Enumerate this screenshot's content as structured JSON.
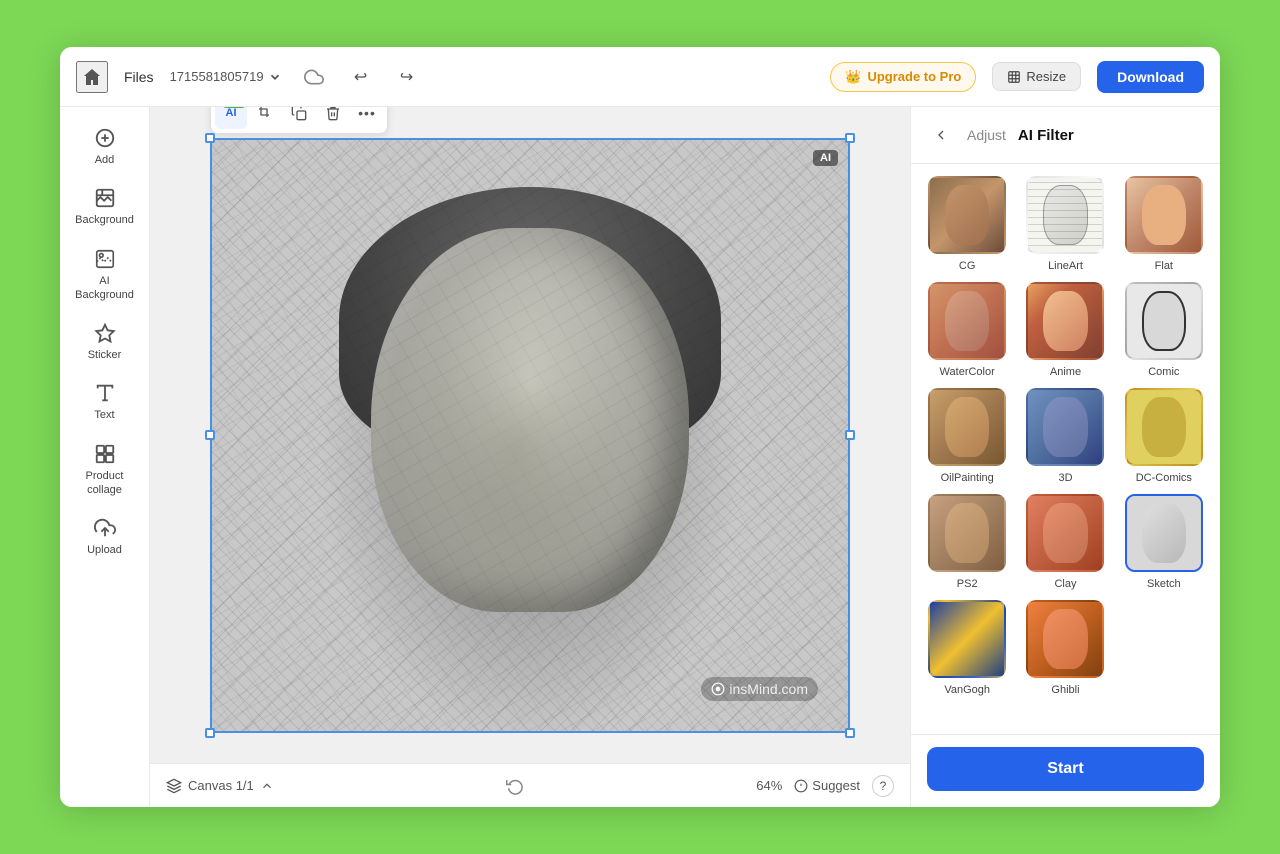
{
  "header": {
    "home_label": "Home",
    "files_label": "Files",
    "filename": "1715581805719",
    "undo_label": "Undo",
    "redo_label": "Redo",
    "upgrade_label": "Upgrade to Pro",
    "resize_label": "Resize",
    "download_label": "Download"
  },
  "sidebar": {
    "items": [
      {
        "id": "add",
        "label": "Add",
        "icon": "plus"
      },
      {
        "id": "background",
        "label": "Background",
        "icon": "background"
      },
      {
        "id": "ai-background",
        "label": "AI Background",
        "icon": "ai-background"
      },
      {
        "id": "sticker",
        "label": "Sticker",
        "icon": "sticker"
      },
      {
        "id": "text",
        "label": "Text",
        "icon": "text"
      },
      {
        "id": "product-collage",
        "label": "Product collage",
        "icon": "product-collage"
      },
      {
        "id": "upload",
        "label": "Upload",
        "icon": "upload"
      }
    ]
  },
  "canvas": {
    "name": "Canvas 1/1",
    "zoom": "64%",
    "suggest_label": "Suggest",
    "help_label": "?",
    "ai_badge": "AI",
    "watermark": "insMind.com"
  },
  "toolbar": {
    "buttons": [
      {
        "id": "ai-tool",
        "label": "AI",
        "has_new": true
      },
      {
        "id": "crop",
        "label": "Crop"
      },
      {
        "id": "duplicate",
        "label": "Duplicate"
      },
      {
        "id": "delete",
        "label": "Delete"
      },
      {
        "id": "more",
        "label": "More"
      }
    ]
  },
  "right_panel": {
    "back_label": "Back",
    "tab_adjust": "Adjust",
    "tab_aifilter": "AI Filter",
    "filters": [
      {
        "id": "cg",
        "label": "CG",
        "thumb_class": "ft-cg",
        "selected": false
      },
      {
        "id": "lineart",
        "label": "LineArt",
        "thumb_class": "ft-lineart",
        "selected": false
      },
      {
        "id": "flat",
        "label": "Flat",
        "thumb_class": "ft-flat",
        "selected": false
      },
      {
        "id": "watercolor",
        "label": "WaterColor",
        "thumb_class": "ft-watercolor",
        "selected": false
      },
      {
        "id": "anime",
        "label": "Anime",
        "thumb_class": "ft-anime",
        "selected": false
      },
      {
        "id": "comic",
        "label": "Comic",
        "thumb_class": "ft-comic",
        "selected": false
      },
      {
        "id": "oilpainting",
        "label": "OilPainting",
        "thumb_class": "ft-oilpainting",
        "selected": false
      },
      {
        "id": "3d",
        "label": "3D",
        "thumb_class": "ft-3d",
        "selected": false
      },
      {
        "id": "dc-comics",
        "label": "DC-Comics",
        "thumb_class": "ft-dccomics",
        "selected": false
      },
      {
        "id": "ps2",
        "label": "PS2",
        "thumb_class": "ft-ps2",
        "selected": false
      },
      {
        "id": "clay",
        "label": "Clay",
        "thumb_class": "ft-clay",
        "selected": false
      },
      {
        "id": "sketch",
        "label": "Sketch",
        "thumb_class": "ft-sketch",
        "selected": true
      },
      {
        "id": "vangogh",
        "label": "VanGogh",
        "thumb_class": "ft-vangogh",
        "selected": false
      },
      {
        "id": "ghibli",
        "label": "Ghibli",
        "thumb_class": "ft-ghibli",
        "selected": false
      }
    ],
    "start_label": "Start"
  }
}
